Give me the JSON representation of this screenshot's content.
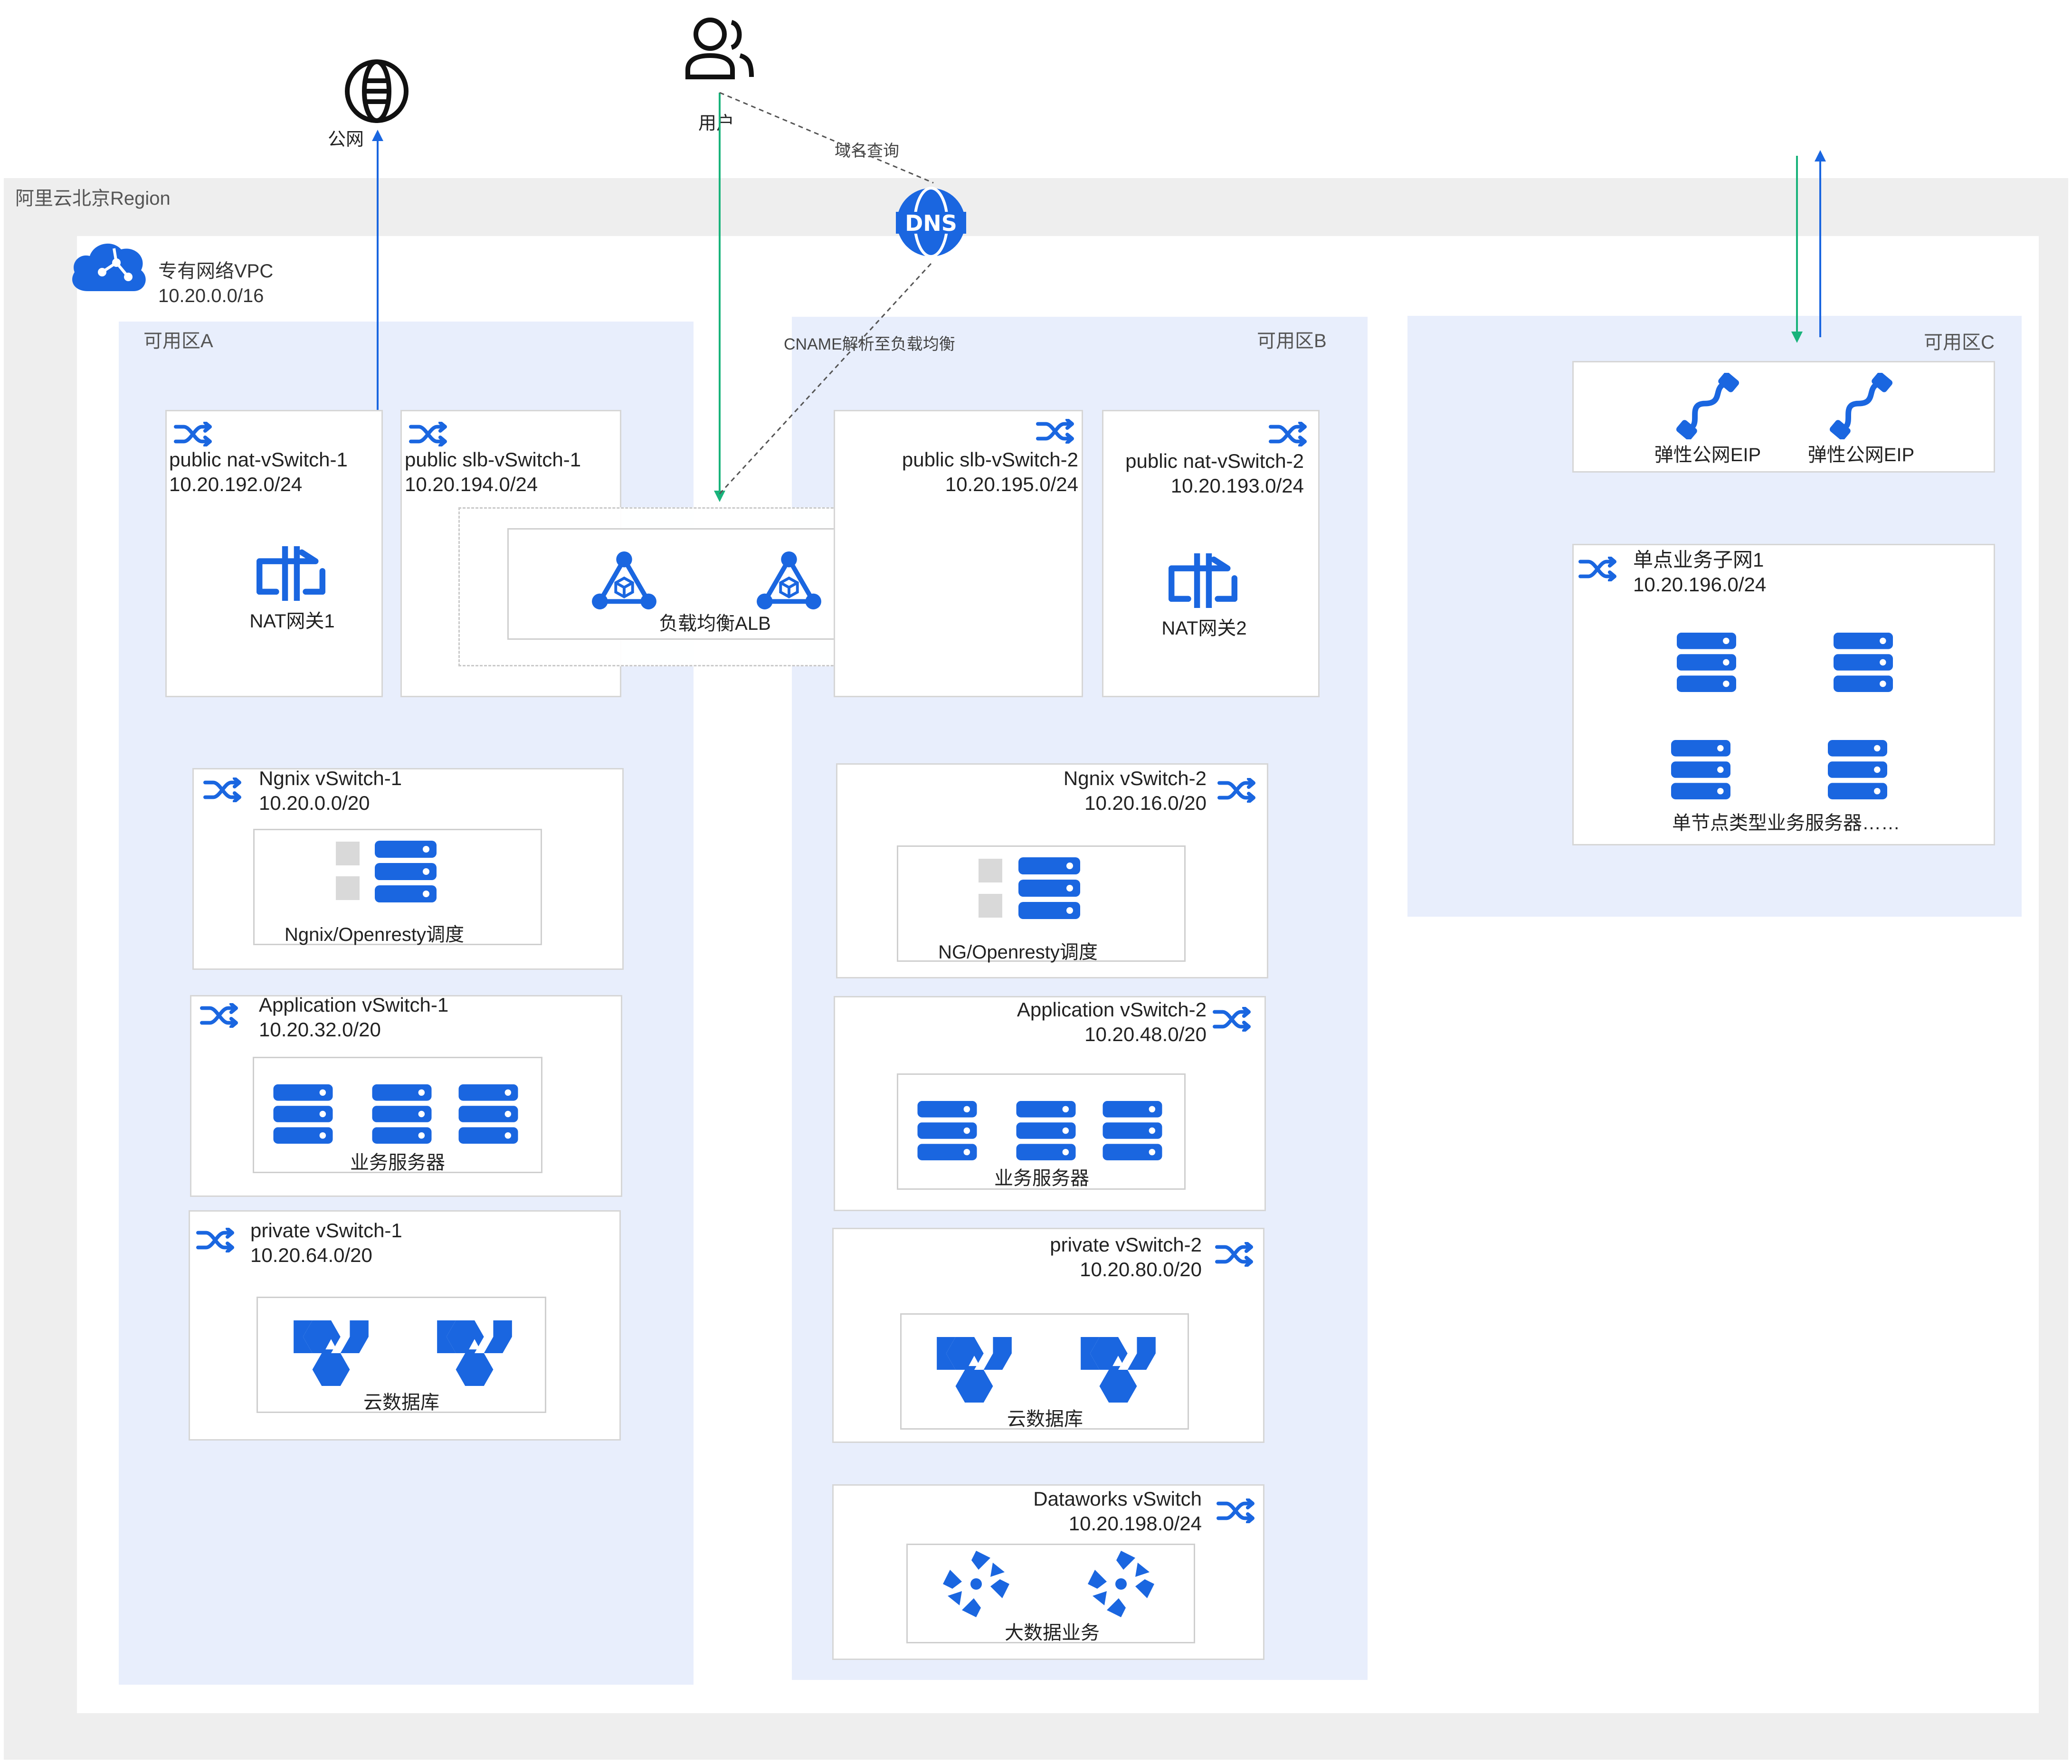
{
  "region": {
    "label": "阿里云北京Region"
  },
  "vpc": {
    "name": "专有网络VPC",
    "cidr": "10.20.0.0/16"
  },
  "top": {
    "internet": "公网",
    "user": "用户",
    "dns_query": "域名查询",
    "cname": "CNAME解析至负载均衡"
  },
  "zones": {
    "a": "可用区A",
    "b": "可用区B",
    "c": "可用区C"
  },
  "zone_a": {
    "nat": {
      "name": "public nat-vSwitch-1",
      "cidr": "10.20.192.0/24",
      "device": "NAT网关1"
    },
    "slb": {
      "name": "public slb-vSwitch-1",
      "cidr": "10.20.194.0/24"
    },
    "ngnix": {
      "name": "Ngnix vSwitch-1",
      "cidr": "10.20.0.0/20",
      "device": "Ngnix/Openresty调度"
    },
    "app": {
      "name": "Application vSwitch-1",
      "cidr": "10.20.32.0/20",
      "device": "业务服务器"
    },
    "private": {
      "name": "private vSwitch-1",
      "cidr": "10.20.64.0/20",
      "device": "云数据库"
    }
  },
  "alb": {
    "label": "负载均衡ALB"
  },
  "zone_b": {
    "slb": {
      "name": "public slb-vSwitch-2",
      "cidr": "10.20.195.0/24"
    },
    "nat": {
      "name": "public nat-vSwitch-2",
      "cidr": "10.20.193.0/24",
      "device": "NAT网关2"
    },
    "ngnix": {
      "name": "Ngnix vSwitch-2",
      "cidr": "10.20.16.0/20",
      "device": "NG/Openresty调度"
    },
    "app": {
      "name": "Application vSwitch-2",
      "cidr": "10.20.48.0/20",
      "device": "业务服务器"
    },
    "private": {
      "name": "private vSwitch-2",
      "cidr": "10.20.80.0/20",
      "device": "云数据库"
    },
    "dataworks": {
      "name": "Dataworks vSwitch",
      "cidr": "10.20.198.0/24",
      "device": "大数据业务"
    }
  },
  "zone_c": {
    "eip1": "弹性公网EIP",
    "eip2": "弹性公网EIP",
    "single": {
      "name": "单点业务子网1",
      "cidr": "10.20.196.0/24",
      "device": "单节点类型业务服务器……"
    }
  },
  "colors": {
    "blue": "#1a66e0",
    "green": "#19b37b",
    "zone_bg": "#e8eefc",
    "region_bg": "#eeeeee"
  },
  "icons": [
    "globe-icon",
    "user-icon",
    "dns-icon",
    "cloud-vpc-icon",
    "vswitch-icon",
    "nat-gateway-icon",
    "load-balancer-icon",
    "server-icon",
    "database-icon",
    "eip-icon",
    "dataworks-icon"
  ]
}
